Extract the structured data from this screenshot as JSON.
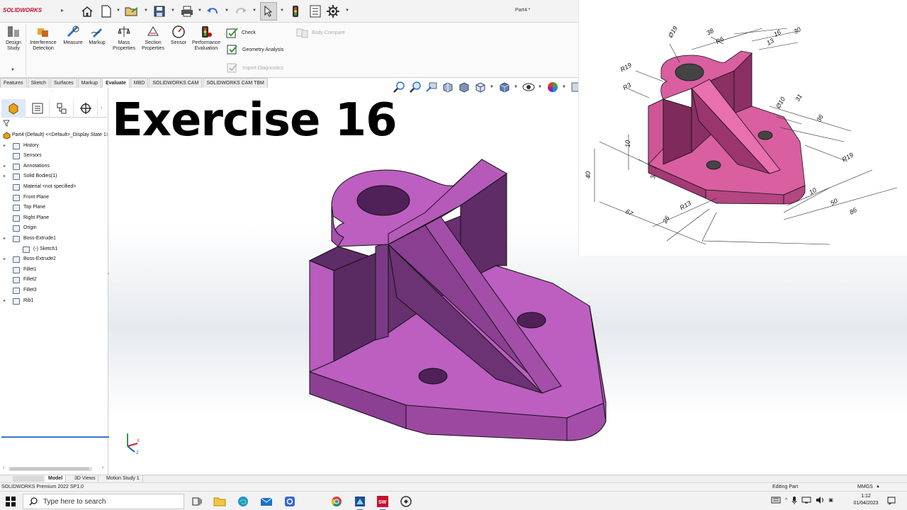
{
  "app": {
    "brand": "SOLIDWORKS",
    "document_title": "Part4 *"
  },
  "ribbon": {
    "buttons": [
      {
        "label": "Design Study",
        "icon": "design-study-icon"
      },
      {
        "label": "Interference Detection",
        "icon": "interference-detection-icon"
      },
      {
        "label": "Measure",
        "icon": "measure-icon"
      },
      {
        "label": "Markup",
        "icon": "markup-icon"
      },
      {
        "label": "Mass Properties",
        "icon": "mass-properties-icon"
      },
      {
        "label": "Section Properties",
        "icon": "section-properties-icon"
      },
      {
        "label": "Sensor",
        "icon": "sensor-icon"
      },
      {
        "label": "Performance Evaluation",
        "icon": "performance-evaluation-icon"
      }
    ],
    "check_label": "Check",
    "geometry_analysis_label": "Geometry Analysis",
    "import_diagnostics_label": "Import Diagnostics",
    "body_compare_label": "Body Compare"
  },
  "command_tabs": [
    "Features",
    "Sketch",
    "Surfaces",
    "Markup",
    "Evaluate",
    "MBD",
    "SOLIDWORKS CAM",
    "SOLIDWORKS CAM TBM"
  ],
  "active_command_tab": "Evaluate",
  "feature_tree": {
    "root": "Part4 (Default) <<Default>_Display State 1>",
    "items": [
      {
        "label": "History",
        "indent": 1,
        "expandable": true
      },
      {
        "label": "Sensors",
        "indent": 1,
        "expandable": false
      },
      {
        "label": "Annotations",
        "indent": 1,
        "expandable": true
      },
      {
        "label": "Solid Bodies(1)",
        "indent": 1,
        "expandable": true
      },
      {
        "label": "Material <not specified>",
        "indent": 1,
        "expandable": false
      },
      {
        "label": "Front Plane",
        "indent": 1,
        "expandable": false
      },
      {
        "label": "Top Plane",
        "indent": 1,
        "expandable": false
      },
      {
        "label": "Right Plane",
        "indent": 1,
        "expandable": false
      },
      {
        "label": "Origin",
        "indent": 1,
        "expandable": false
      },
      {
        "label": "Boss-Extrude1",
        "indent": 1,
        "expandable": true
      },
      {
        "label": "(-) Sketch1",
        "indent": 2,
        "expandable": false
      },
      {
        "label": "Boss-Extrude2",
        "indent": 1,
        "expandable": true
      },
      {
        "label": "Fillet1",
        "indent": 1,
        "expandable": false
      },
      {
        "label": "Fillet2",
        "indent": 1,
        "expandable": false
      },
      {
        "label": "Fillet3",
        "indent": 1,
        "expandable": false
      },
      {
        "label": "Rib1",
        "indent": 1,
        "expandable": true
      }
    ]
  },
  "viewport": {
    "overlay_title": "Exercise 16",
    "model_color": "#b95fbe"
  },
  "reference_drawing": {
    "model_color": "#d95fa0",
    "dimensions": [
      "Ø19",
      "38",
      "R6",
      "13",
      "16",
      "30",
      "R19",
      "R3",
      "Ø10",
      "31",
      "36",
      "10",
      "3",
      "40",
      "R19",
      "10",
      "R13",
      "50",
      "86",
      "67",
      "26"
    ]
  },
  "bottom_tabs": [
    "Model",
    "3D Views",
    "Motion Study 1"
  ],
  "active_bottom_tab": "Model",
  "status": {
    "product": "SOLIDWORKS Premium 2022 SP1.0",
    "mode": "Editing Part",
    "units": "MMGS"
  },
  "taskbar": {
    "search_placeholder": "Type here to search",
    "time": "1:12",
    "date": "01/04/2023"
  }
}
